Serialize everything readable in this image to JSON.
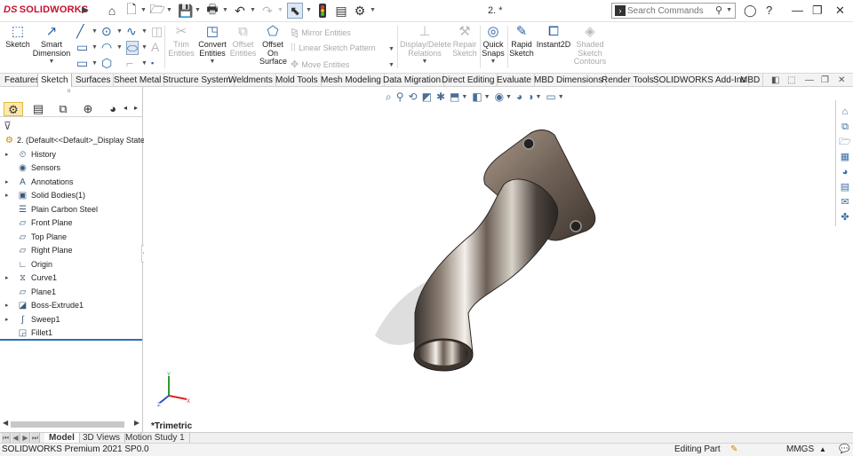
{
  "app": {
    "logo": "SOLIDWORKS",
    "doc_title": "2. *"
  },
  "search": {
    "placeholder": "Search Commands"
  },
  "ribbon": {
    "sketch": "Sketch",
    "smart_dimension": [
      "Smart",
      "Dimension"
    ],
    "trim_entities": [
      "Trim",
      "Entities"
    ],
    "convert_entities": [
      "Convert",
      "Entities"
    ],
    "offset_entities": [
      "Offset",
      "Entities"
    ],
    "offset_on_surface": [
      "Offset",
      "On",
      "Surface"
    ],
    "mirror_entities": "Mirror Entities",
    "linear_sketch_pattern": "Linear Sketch Pattern",
    "move_entities": "Move Entities",
    "display_delete_relations": [
      "Display/Delete",
      "Relations"
    ],
    "repair_sketch": [
      "Repair",
      "Sketch"
    ],
    "quick_snaps": [
      "Quick",
      "Snaps"
    ],
    "rapid_sketch": [
      "Rapid",
      "Sketch"
    ],
    "instant2d": "Instant2D",
    "shaded_sketch_contours": [
      "Shaded",
      "Sketch",
      "Contours"
    ]
  },
  "command_tabs": [
    {
      "label": "Features",
      "active": false
    },
    {
      "label": "Sketch",
      "active": true
    },
    {
      "label": "Surfaces",
      "active": false
    },
    {
      "label": "Sheet Metal",
      "active": false
    },
    {
      "label": "Structure System",
      "active": false
    },
    {
      "label": "Weldments",
      "active": false
    },
    {
      "label": "Mold Tools",
      "active": false
    },
    {
      "label": "Mesh Modeling",
      "active": false
    },
    {
      "label": "Data Migration",
      "active": false
    },
    {
      "label": "Direct Editing",
      "active": false
    },
    {
      "label": "Evaluate",
      "active": false
    },
    {
      "label": "MBD Dimensions",
      "active": false
    },
    {
      "label": "Render Tools",
      "active": false
    },
    {
      "label": "SOLIDWORKS Add-Ins",
      "active": false
    },
    {
      "label": "MBD",
      "active": false
    }
  ],
  "feature_tree": {
    "root": "2.  (Default<<Default>_Display State 1",
    "items": [
      {
        "label": "History",
        "icon": "history-icon",
        "expandable": true
      },
      {
        "label": "Sensors",
        "icon": "sensors-icon",
        "expandable": false
      },
      {
        "label": "Annotations",
        "icon": "annotations-icon",
        "expandable": true
      },
      {
        "label": "Solid Bodies(1)",
        "icon": "solid-bodies-icon",
        "expandable": true
      },
      {
        "label": "Plain Carbon Steel",
        "icon": "material-icon",
        "expandable": false
      },
      {
        "label": "Front Plane",
        "icon": "plane-icon",
        "expandable": false
      },
      {
        "label": "Top Plane",
        "icon": "plane-icon",
        "expandable": false
      },
      {
        "label": "Right Plane",
        "icon": "plane-icon",
        "expandable": false
      },
      {
        "label": "Origin",
        "icon": "origin-icon",
        "expandable": false
      },
      {
        "label": "Curve1",
        "icon": "curve-icon",
        "expandable": true
      },
      {
        "label": "Plane1",
        "icon": "plane-icon",
        "expandable": false
      },
      {
        "label": "Boss-Extrude1",
        "icon": "extrude-icon",
        "expandable": true
      },
      {
        "label": "Sweep1",
        "icon": "sweep-icon",
        "expandable": true
      },
      {
        "label": "Fillet1",
        "icon": "fillet-icon",
        "expandable": false
      }
    ]
  },
  "graphics": {
    "view_label": "*Trimetric"
  },
  "bottom_tabs": [
    {
      "label": "Model",
      "active": true
    },
    {
      "label": "3D Views",
      "active": false
    },
    {
      "label": "Motion Study 1",
      "active": false
    }
  ],
  "status": {
    "version": "SOLIDWORKS Premium 2021 SP0.0",
    "mode": "Editing Part",
    "units": "MMGS"
  },
  "colors": {
    "brand": "#c8102e",
    "accent": "#2d6fb5"
  }
}
